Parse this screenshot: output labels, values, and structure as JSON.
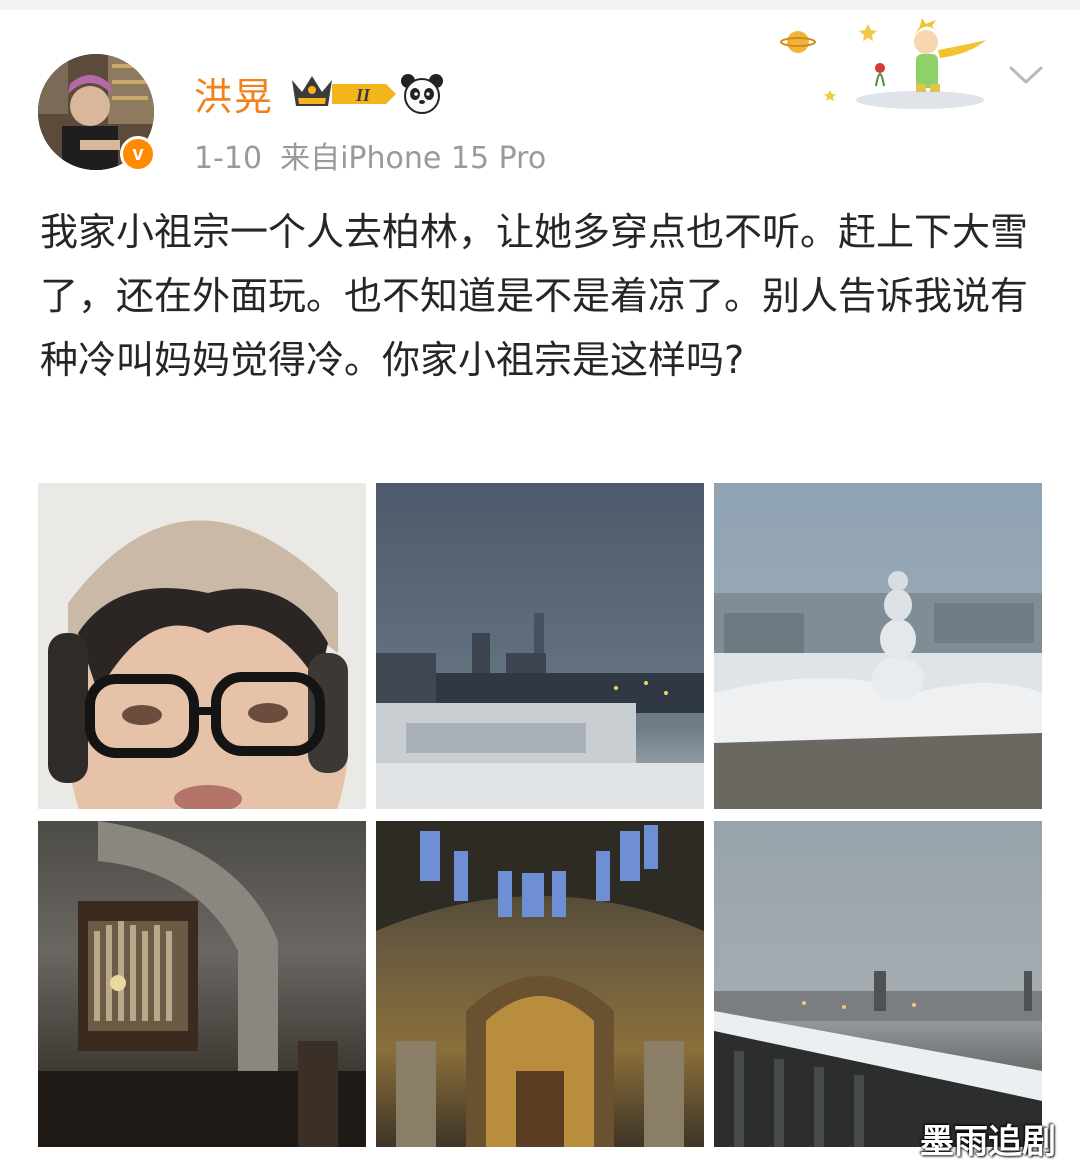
{
  "post": {
    "username": "洪晃",
    "vip_level": "II",
    "date": "1-10",
    "source": "来自iPhone 15 Pro",
    "text": "我家小祖宗一个人去柏林，让她多穿点也不听。赶上下大雪了，还在外面玩。也不知道是不是着凉了。别人告诉我说有种冷叫妈妈觉得冷。你家小祖宗是这样吗?"
  },
  "watermark": "墨雨追剧",
  "colors": {
    "username": "#f0821e",
    "meta": "#9a9a9a",
    "text": "#262626",
    "verified": "#ff8a00"
  },
  "icons": {
    "verified": "verified-v-icon",
    "vip": "vip-crown-badge",
    "panda": "panda-icon",
    "menu": "chevron-down-icon"
  }
}
